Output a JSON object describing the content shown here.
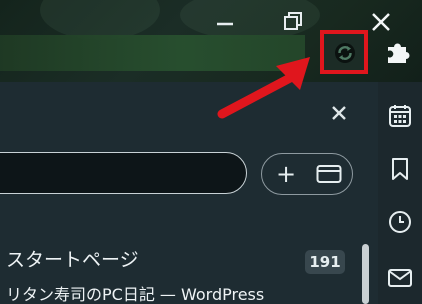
{
  "window": {
    "buttons": [
      {
        "name": "minimize",
        "icon": "minimize-icon"
      },
      {
        "name": "restore",
        "icon": "restore-icon"
      },
      {
        "name": "close",
        "icon": "close-icon"
      }
    ]
  },
  "toolbar": {
    "extension_icon": "sync-extension-icon",
    "extensions_icon": "puzzle-icon",
    "highlight_color": "#e0161d"
  },
  "panel": {
    "close_icon": "close-icon",
    "search": {
      "value": "",
      "placeholder": ""
    },
    "add_icon": "plus-icon",
    "add_label": "+",
    "folder_icon": "folder-icon",
    "group": {
      "title": "スタートページ",
      "count": "191"
    },
    "item": {
      "title": "リタン寿司のPC日記 — WordPress"
    }
  },
  "sidebar": {
    "icons": [
      "calendar-icon",
      "bookmark-icon",
      "clock-icon",
      "mail-icon"
    ]
  },
  "colors": {
    "panel_bg": "#1e2c32",
    "accent_red": "#e0161d",
    "badge_bg": "#38474e"
  }
}
